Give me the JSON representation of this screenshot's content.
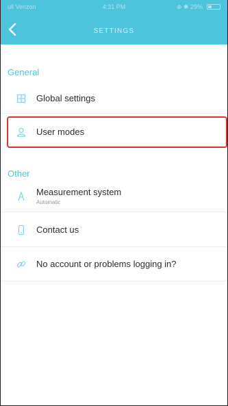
{
  "status_bar": {
    "carrier": "ull Verizon",
    "time": "4:31 PM",
    "battery_text": "⊕ ✱ 29%"
  },
  "header": {
    "title": "SETTINGS",
    "back_icon": "chevron-left-icon"
  },
  "sections": [
    {
      "title": "General",
      "items": [
        {
          "icon": "grid-settings-icon",
          "label": "Global settings",
          "sublabel": ""
        },
        {
          "icon": "user-icon",
          "label": "User modes",
          "sublabel": ""
        }
      ]
    },
    {
      "title": "Other",
      "items": [
        {
          "icon": "ruler-icon",
          "label": "Measurement system",
          "sublabel": "Automatic"
        },
        {
          "icon": "phone-icon",
          "label": "Contact us",
          "sublabel": ""
        },
        {
          "icon": "link-icon",
          "label": "No account or problems logging in?",
          "sublabel": ""
        }
      ]
    }
  ],
  "colors": {
    "accent": "#4dc3dc",
    "highlight_border": "#e0322c",
    "icon": "#7ed3e6"
  }
}
